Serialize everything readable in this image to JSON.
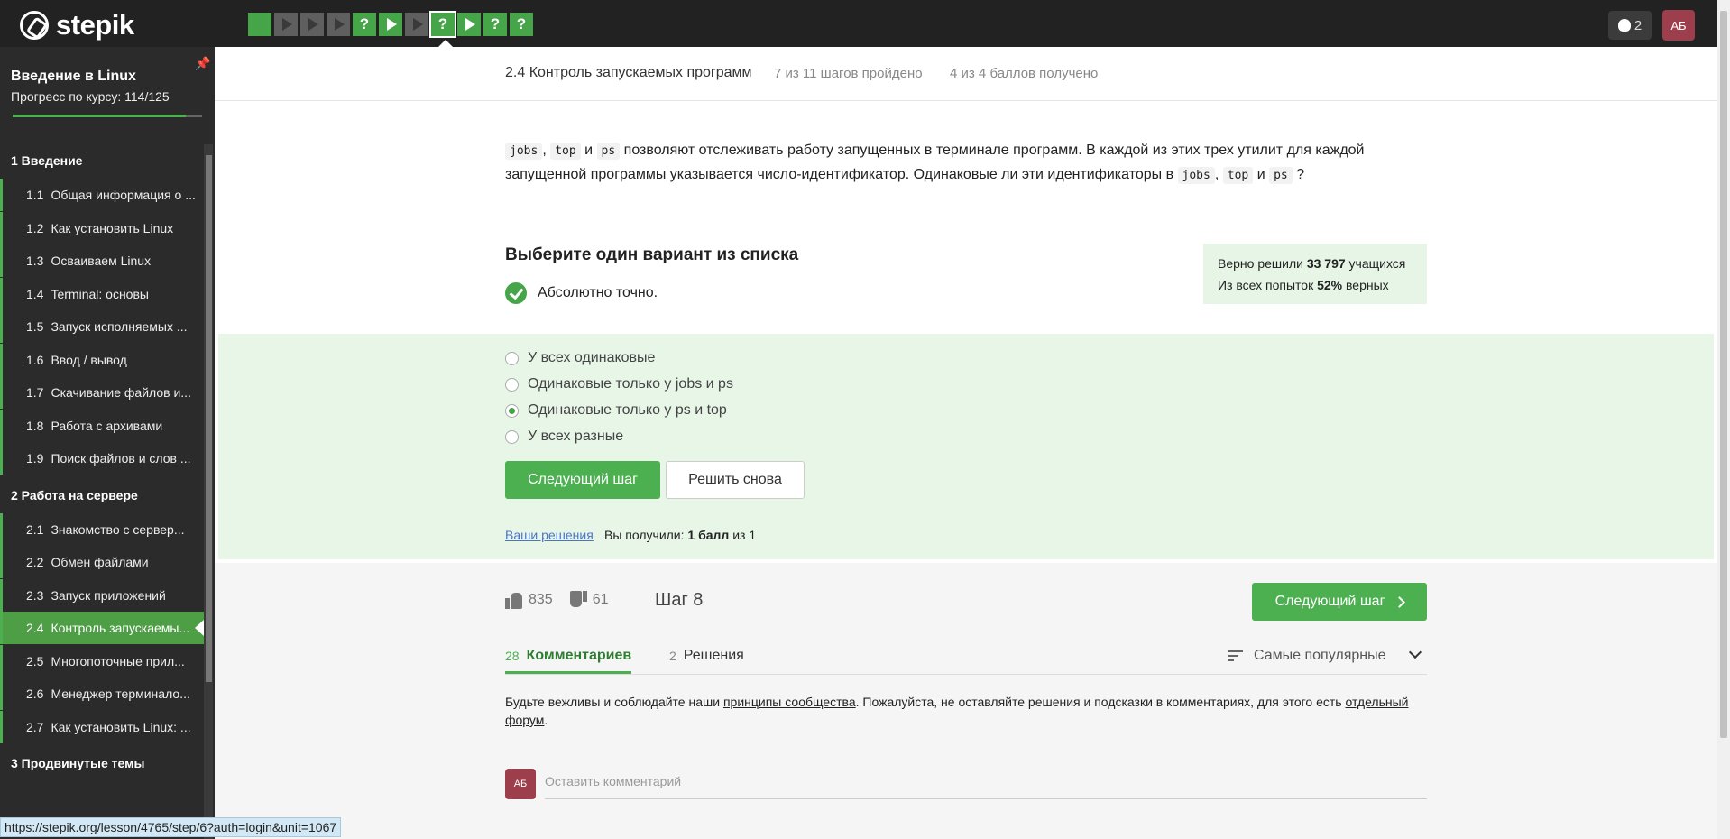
{
  "header": {
    "logo_text": "stepik",
    "steps": [
      {
        "type": "square",
        "color": "green"
      },
      {
        "type": "play",
        "color": "gray"
      },
      {
        "type": "play",
        "color": "gray"
      },
      {
        "type": "play",
        "color": "gray"
      },
      {
        "type": "quiz",
        "color": "green",
        "label": "?"
      },
      {
        "type": "play",
        "color": "green"
      },
      {
        "type": "play",
        "color": "gray"
      },
      {
        "type": "quiz",
        "color": "green",
        "label": "?",
        "current": true
      },
      {
        "type": "play",
        "color": "green"
      },
      {
        "type": "quiz",
        "color": "green",
        "label": "?"
      },
      {
        "type": "quiz",
        "color": "green",
        "label": "?"
      }
    ],
    "notifications_count": "2",
    "avatar_initials": "АБ"
  },
  "sidebar": {
    "course_title": "Введение в Linux",
    "progress_label": "Прогресс по курсу:  114/125",
    "progress_fraction": 0.912,
    "sections": [
      {
        "label": "1  Введение",
        "lessons": [
          {
            "num": "1.1",
            "title": "Общая информация о ..."
          },
          {
            "num": "1.2",
            "title": "Как установить Linux"
          },
          {
            "num": "1.3",
            "title": "Осваиваем Linux"
          },
          {
            "num": "1.4",
            "title": "Terminal: основы"
          },
          {
            "num": "1.5",
            "title": "Запуск исполняемых ..."
          },
          {
            "num": "1.6",
            "title": "Ввод / вывод"
          },
          {
            "num": "1.7",
            "title": "Скачивание файлов и..."
          },
          {
            "num": "1.8",
            "title": "Работа с архивами"
          },
          {
            "num": "1.9",
            "title": "Поиск файлов и слов ..."
          }
        ]
      },
      {
        "label": "2  Работа на сервере",
        "lessons": [
          {
            "num": "2.1",
            "title": "Знакомство с сервер..."
          },
          {
            "num": "2.2",
            "title": "Обмен файлами"
          },
          {
            "num": "2.3",
            "title": "Запуск приложений"
          },
          {
            "num": "2.4",
            "title": "Контроль запускаемы...",
            "active": true
          },
          {
            "num": "2.5",
            "title": "Многопоточные прил..."
          },
          {
            "num": "2.6",
            "title": "Менеджер терминало..."
          },
          {
            "num": "2.7",
            "title": "Как установить Linux: ..."
          }
        ]
      },
      {
        "label": "3  Продвинутые темы",
        "lessons": []
      }
    ]
  },
  "lesson_header": {
    "title": "2.4 Контроль запускаемых программ",
    "steps_passed": "7 из 11 шагов пройдено",
    "points": "4 из 4 баллов  получено"
  },
  "question": {
    "code1": "jobs",
    "sep1": ",",
    "code2": "top",
    "and1": "и",
    "code3": "ps",
    "text1": "позволяют отслеживать работу запущенных в терминале программ. В каждой из этих трех утилит для каждой запущенной программы указывается число-идентификатор. Одинаковые ли эти идентификаторы в",
    "code4": "jobs",
    "sep2": ",",
    "code5": "top",
    "and2": "и",
    "code6": "ps",
    "end": "?"
  },
  "quiz": {
    "choose_label": "Выберите один вариант из списка",
    "feedback": "Абсолютно точно.",
    "stats_line1_prefix": "Верно решили",
    "stats_line1_value": "33 797",
    "stats_line1_suffix": "учащихся",
    "stats_line2_prefix": "Из всех попыток",
    "stats_line2_value": "52%",
    "stats_line2_suffix": "верных",
    "options": [
      {
        "label": "У всех одинаковые",
        "checked": false
      },
      {
        "label": "Одинаковые только у jobs и ps",
        "checked": false
      },
      {
        "label": "Одинаковые только у ps и top",
        "checked": true
      },
      {
        "label": "У всех разные",
        "checked": false
      }
    ],
    "next_button": "Следующий шаг",
    "retry_button": "Решить снова",
    "your_solutions": "Ваши решения",
    "score_prefix": "Вы получили:",
    "score_value": "1 балл",
    "score_suffix": "из 1"
  },
  "footer": {
    "likes": "835",
    "dislikes": "61",
    "step_label": "Шаг 8",
    "next_button": "Следующий шаг",
    "tabs": [
      {
        "count": "28",
        "label": "Комментариев",
        "active": true
      },
      {
        "count": "2",
        "label": "Решения",
        "active": false
      }
    ],
    "sort_label": "Самые популярные",
    "rules_text1": "Будьте вежливы и соблюдайте наши",
    "rules_link1": "принципы сообщества",
    "rules_text2": ". Пожалуйста, не оставляйте решения и подсказки в комментариях, для этого есть",
    "rules_link2": "отдельный форум",
    "rules_text3": ".",
    "comment_avatar": "АБ",
    "comment_placeholder": "Оставить комментарий"
  },
  "status_url": "https://stepik.org/lesson/4765/step/6?auth=login&unit=1067"
}
